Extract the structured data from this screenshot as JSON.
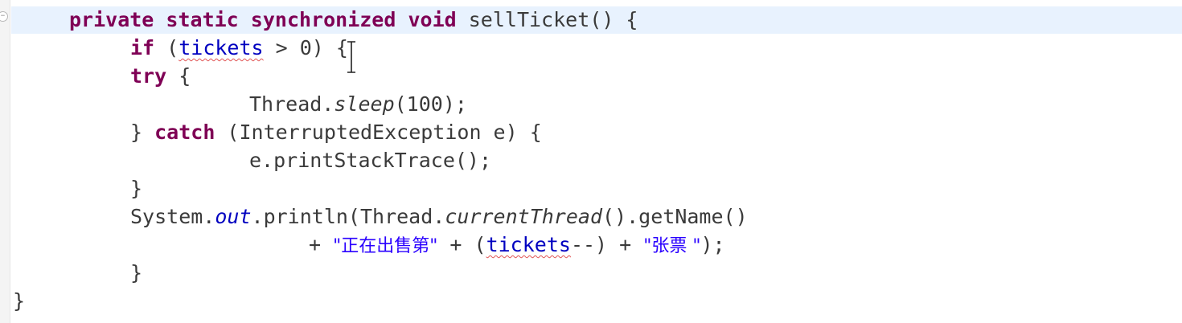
{
  "code_lines": [
    {
      "tokens": [
        {
          "text": "private",
          "cls": "kw"
        },
        {
          "text": " "
        },
        {
          "text": "static",
          "cls": "kw"
        },
        {
          "text": " "
        },
        {
          "text": "synchronized",
          "cls": "kw"
        },
        {
          "text": " "
        },
        {
          "text": "void",
          "cls": "kw"
        },
        {
          "text": " sellTicket() {"
        }
      ]
    },
    {
      "tokens": [
        {
          "text": "if",
          "cls": "kw"
        },
        {
          "text": " ("
        },
        {
          "text": "tickets",
          "cls": "field squiggle"
        },
        {
          "text": " > 0) {"
        }
      ]
    },
    {
      "tokens": [
        {
          "text": "try",
          "cls": "kw"
        },
        {
          "text": " {"
        }
      ]
    },
    {
      "tokens": [
        {
          "text": "Thread."
        },
        {
          "text": "sleep",
          "cls": "italic"
        },
        {
          "text": "(100);"
        }
      ]
    },
    {
      "tokens": [
        {
          "text": "} "
        },
        {
          "text": "catch",
          "cls": "kw"
        },
        {
          "text": " (InterruptedException e) {"
        }
      ]
    },
    {
      "tokens": [
        {
          "text": "e.printStackTrace();"
        }
      ]
    },
    {
      "tokens": [
        {
          "text": "}"
        }
      ]
    },
    {
      "tokens": [
        {
          "text": "System."
        },
        {
          "text": "out",
          "cls": "field italic"
        },
        {
          "text": ".println(Thread."
        },
        {
          "text": "currentThread",
          "cls": "italic"
        },
        {
          "text": "().getName()"
        }
      ]
    },
    {
      "tokens": [
        {
          "text": "+ "
        },
        {
          "text": "\"正在出售第\"",
          "cls": "str"
        },
        {
          "text": " + ("
        },
        {
          "text": "tickets",
          "cls": "field squiggle"
        },
        {
          "text": "--) + "
        },
        {
          "text": "\"张票 \"",
          "cls": "str"
        },
        {
          "text": ");"
        }
      ]
    },
    {
      "tokens": [
        {
          "text": "}"
        }
      ]
    },
    {
      "tokens": [
        {
          "text": "}"
        }
      ]
    }
  ],
  "colors": {
    "keyword": "#7f0055",
    "field": "#0000c0",
    "string": "#2a00ff",
    "current_line": "#e8f2fe"
  },
  "icons": {
    "fold_marker": "fold-collapse-icon",
    "cursor": "text-cursor-icon"
  }
}
